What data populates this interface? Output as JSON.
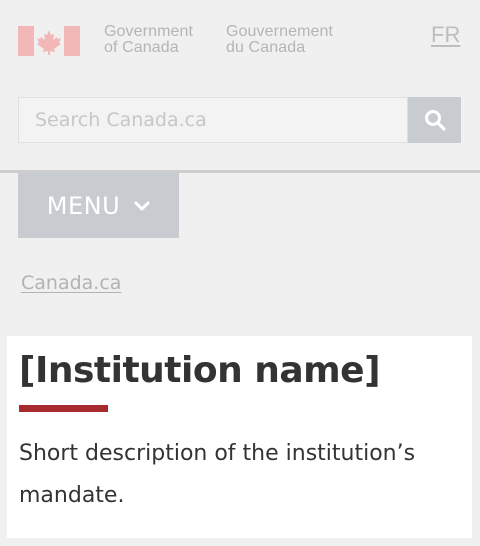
{
  "header": {
    "gov_en_line1": "Government",
    "gov_en_line2": "of Canada",
    "gov_fr_line1": "Gouvernement",
    "gov_fr_line2": "du Canada",
    "language_toggle": "FR"
  },
  "search": {
    "placeholder": "Search Canada.ca",
    "button_icon": "search-icon"
  },
  "menu": {
    "label": "MENU",
    "icon": "chevron-down-icon"
  },
  "breadcrumb": {
    "items": [
      "Canada.ca"
    ]
  },
  "main": {
    "title": "[Institution name]",
    "description": "Short description of the institution’s mandate."
  },
  "colors": {
    "flag_red": "#f2b8b8",
    "title_accent": "#a62a2e",
    "button_gray": "#c8cbcf"
  }
}
